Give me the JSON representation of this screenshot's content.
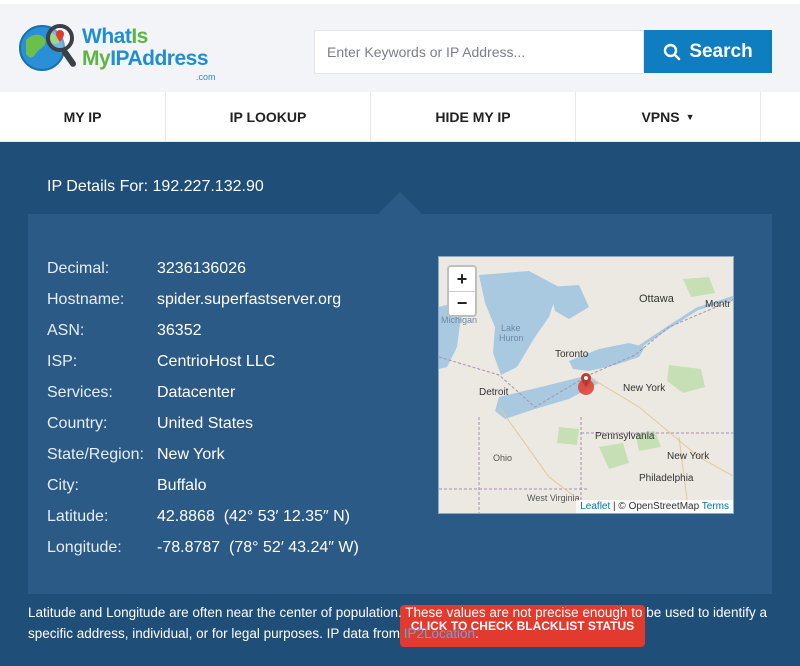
{
  "logo": {
    "line1_a": "What",
    "line1_b": "Is",
    "line2_a": "My",
    "line2_b": "IPAddress",
    "suffix": ".com"
  },
  "search": {
    "placeholder": "Enter Keywords or IP Address...",
    "value": "",
    "button_label": "Search"
  },
  "nav": {
    "items": [
      {
        "label": "MY IP"
      },
      {
        "label": "IP LOOKUP"
      },
      {
        "label": "HIDE MY IP"
      },
      {
        "label": "VPNS"
      }
    ]
  },
  "ip_details": {
    "title": "IP Details For: 192.227.132.90",
    "rows": [
      {
        "label": "Decimal:",
        "value": "3236136026"
      },
      {
        "label": "Hostname:",
        "value": "spider.superfastserver.org"
      },
      {
        "label": "ASN:",
        "value": "36352"
      },
      {
        "label": "ISP:",
        "value": "CentrioHost LLC"
      },
      {
        "label": "Services:",
        "value": "Datacenter"
      },
      {
        "label": "Country:",
        "value": "United States"
      },
      {
        "label": "State/Region:",
        "value": "New York"
      },
      {
        "label": "City:",
        "value": "Buffalo"
      },
      {
        "label": "Latitude:",
        "value": "42.8868  (42° 53′ 12.35″ N)"
      },
      {
        "label": "Longitude:",
        "value": "-78.8787  (78° 52′ 43.24″ W)"
      }
    ]
  },
  "map": {
    "zoom_in": "+",
    "zoom_out": "−",
    "labels": {
      "ottawa": "Ottawa",
      "montreal": "Montr",
      "michigan": "Michigan",
      "lake_huron_1": "Lake",
      "lake_huron_2": "Huron",
      "toronto": "Toronto",
      "detroit": "Detroit",
      "new_york_state": "New York",
      "pennsylvania": "Pennsylvania",
      "ohio": "Ohio",
      "new_york_city": "New York",
      "philadelphia": "Philadelphia",
      "west_virginia": "West Virginia"
    },
    "attribution": {
      "leaflet": "Leaflet",
      "separator": " | © OpenStreetMap ",
      "terms": "Terms"
    }
  },
  "blacklist_button": "CLICK TO CHECK BLACKLIST STATUS",
  "note": {
    "text": "Latitude and Longitude are often near the center of population. These values are not precise enough to be used to identify a specific address, individual, or for legal purposes. IP data from ",
    "link": "IP2Location",
    "end": "."
  },
  "colors": {
    "brand_blue": "#1f8fd1",
    "brand_green": "#5eb544",
    "band": "#1f4e79",
    "panel": "#2c5a86",
    "search_button": "#0f7ec0",
    "blacklist_button": "#e23a2e"
  }
}
